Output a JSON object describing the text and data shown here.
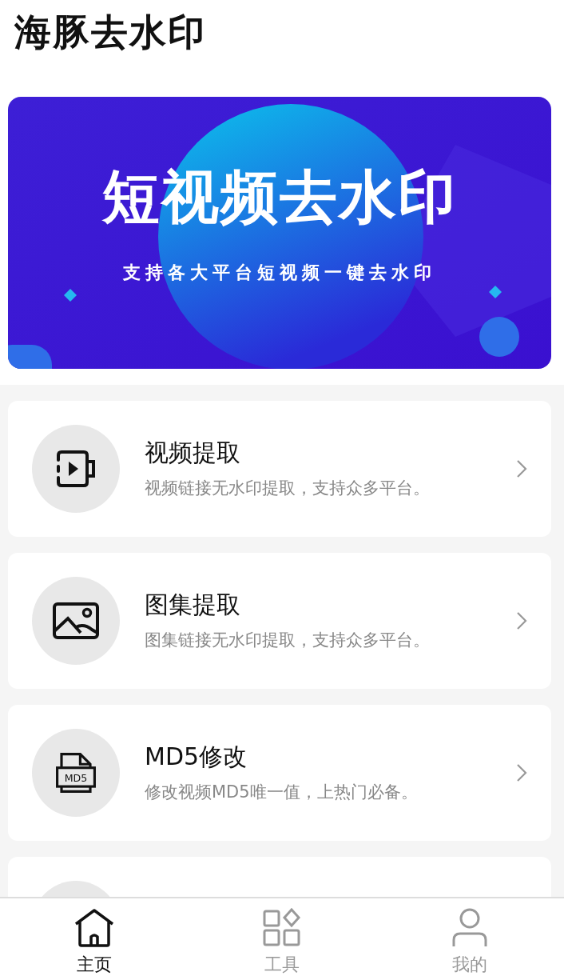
{
  "app_title": "海豚去水印",
  "banner": {
    "kind": "picture",
    "title": "短视频去水印",
    "subtitle": "支持各大平台短视频一键去水印"
  },
  "features": [
    {
      "kind": "video",
      "title": "视频提取",
      "subtitle": "视频链接无水印提取，支持众多平台。"
    },
    {
      "kind": "gallery",
      "title": "图集提取",
      "subtitle": "图集链接无水印提取，支持众多平台。"
    },
    {
      "kind": "md5",
      "icon_label": "MD5",
      "title": "MD5修改",
      "subtitle": "修改视频MD5唯一值，上热门必备。"
    },
    {
      "kind": "hidden"
    }
  ],
  "tabs": [
    {
      "kind": "home",
      "label": "主页",
      "selected": true
    },
    {
      "kind": "tools",
      "label": "工具",
      "selected": false
    },
    {
      "kind": "profile",
      "label": "我的",
      "selected": false
    }
  ]
}
